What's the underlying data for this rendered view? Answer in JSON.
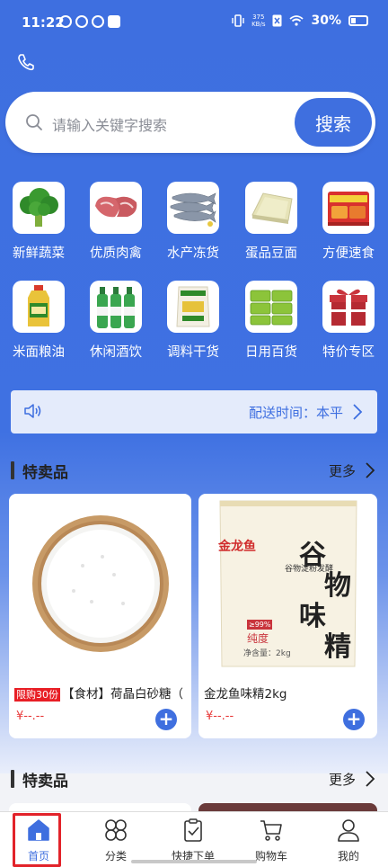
{
  "status_bar": {
    "time": "11:22",
    "speed_value": "375",
    "speed_unit": "KB/s",
    "battery": "30%"
  },
  "search": {
    "placeholder": "请输入关键字搜索",
    "button_label": "搜索"
  },
  "categories": [
    {
      "label": "新鲜蔬菜",
      "icon": "broccoli-icon"
    },
    {
      "label": "优质肉禽",
      "icon": "meat-icon"
    },
    {
      "label": "水产冻货",
      "icon": "fish-icon"
    },
    {
      "label": "蛋品豆面",
      "icon": "tofu-icon"
    },
    {
      "label": "方便速食",
      "icon": "instant-noodles-icon"
    },
    {
      "label": "米面粮油",
      "icon": "oil-bottle-icon"
    },
    {
      "label": "休闲酒饮",
      "icon": "drink-bottles-icon"
    },
    {
      "label": "调料干货",
      "icon": "seasoning-bag-icon"
    },
    {
      "label": "日用百货",
      "icon": "tissue-pack-icon"
    },
    {
      "label": "特价专区",
      "icon": "gift-box-icon"
    }
  ],
  "notice": {
    "text": "配送时间：本平"
  },
  "sections": [
    {
      "title": "特卖品",
      "more": "更多",
      "products": [
        {
          "tag": "限购30份",
          "name": "【食材】荷晶白砂糖（",
          "price": "¥--.--"
        },
        {
          "tag": "",
          "name": "金龙鱼味精2kg",
          "price": "¥--.--"
        }
      ]
    },
    {
      "title": "特卖品",
      "more": "更多"
    }
  ],
  "package_text": {
    "brand": "金龙鱼",
    "title_chars": [
      "谷",
      "物",
      "味",
      "精"
    ],
    "subtitle": "谷物淀粉发酵",
    "purity": "≥99%",
    "purity_label": "纯度",
    "net": "净含量：2kg"
  },
  "tabbar": [
    {
      "label": "首页",
      "icon": "home-icon",
      "active": true
    },
    {
      "label": "分类",
      "icon": "category-icon",
      "active": false
    },
    {
      "label": "快捷下单",
      "icon": "clipboard-icon",
      "active": false
    },
    {
      "label": "购物车",
      "icon": "cart-icon",
      "active": false
    },
    {
      "label": "我的",
      "icon": "user-icon",
      "active": false
    }
  ],
  "colors": {
    "primary": "#3f6fdf",
    "price": "#e83a3a",
    "tag": "#e81e25"
  }
}
